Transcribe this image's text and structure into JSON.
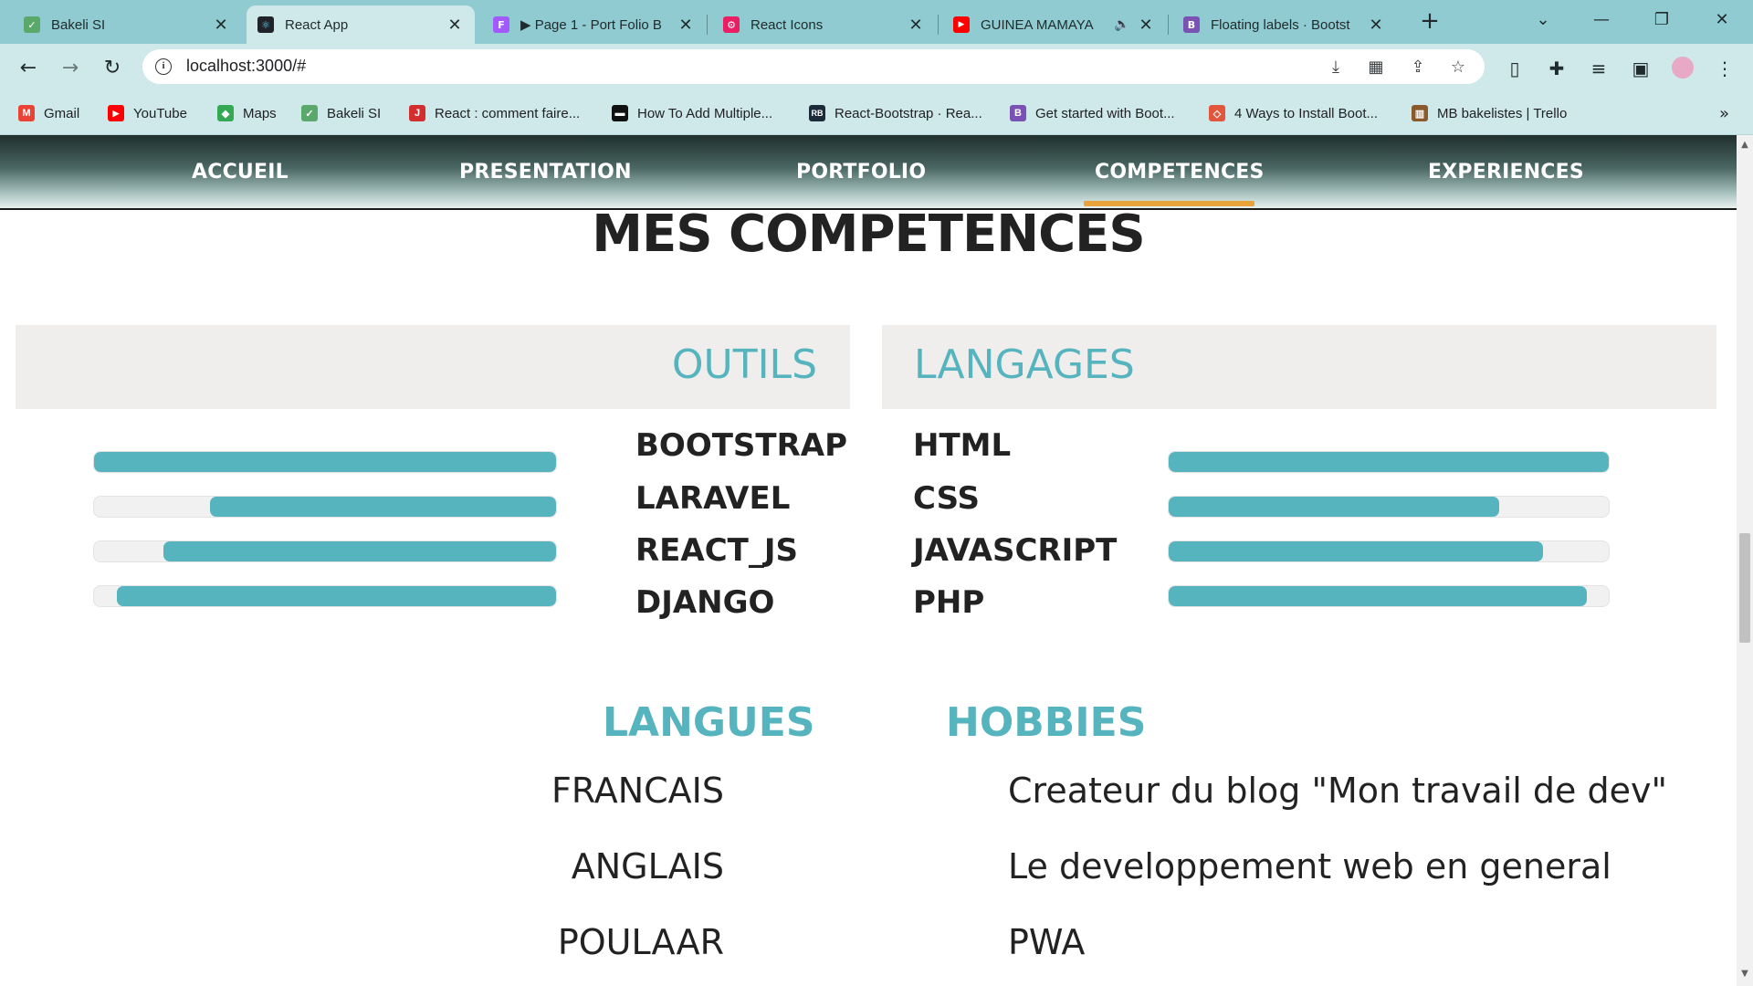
{
  "browser": {
    "tabs": [
      {
        "title": "Bakeli SI",
        "fav_color": "#5aa86a",
        "fav_glyph": "✓"
      },
      {
        "title": "React App",
        "fav_color": "#20232a",
        "fav_glyph": "⚛"
      },
      {
        "title": "▶ Page 1 - Port Folio B",
        "fav_color": "#a259ff",
        "fav_glyph": "F"
      },
      {
        "title": "React Icons",
        "fav_color": "#e91e63",
        "fav_glyph": "⚙"
      },
      {
        "title": "GUINEA MAMAYA",
        "fav_color": "#ff0000",
        "fav_glyph": "▶"
      },
      {
        "title": "Floating labels · Bootst",
        "fav_color": "#7952b3",
        "fav_glyph": "B"
      }
    ],
    "active_tab_index": 1,
    "url": "localhost:3000/#",
    "bookmarks": [
      {
        "label": "Gmail",
        "fav_color": "#ea4335",
        "fav_glyph": "M"
      },
      {
        "label": "YouTube",
        "fav_color": "#ff0000",
        "fav_glyph": "▶"
      },
      {
        "label": "Maps",
        "fav_color": "#34a853",
        "fav_glyph": "◆"
      },
      {
        "label": "Bakeli SI",
        "fav_color": "#5aa86a",
        "fav_glyph": "✓"
      },
      {
        "label": "React : comment faire...",
        "fav_color": "#d32f2f",
        "fav_glyph": "J"
      },
      {
        "label": "How To Add Multiple...",
        "fav_color": "#111111",
        "fav_glyph": "▬"
      },
      {
        "label": "React-Bootstrap · Rea...",
        "fav_color": "#1c2b3a",
        "fav_glyph": "RB"
      },
      {
        "label": "Get started with Boot...",
        "fav_color": "#7952b3",
        "fav_glyph": "B"
      },
      {
        "label": "4 Ways to Install Boot...",
        "fav_color": "#e2563b",
        "fav_glyph": "◇"
      },
      {
        "label": "MB bakelistes | Trello",
        "fav_color": "#8a5a2b",
        "fav_glyph": "▥"
      }
    ]
  },
  "site": {
    "nav": [
      "ACCUEIL",
      "PRESENTATION",
      "PORTFOLIO",
      "COMPETENCES",
      "EXPERIENCES"
    ],
    "active_nav": "COMPETENCES",
    "section_title": "MES COMPETENCES",
    "tools": {
      "heading": "OUTILS",
      "items": [
        {
          "label": "BOOTSTRAP",
          "level": 1.0
        },
        {
          "label": "LARAVEL",
          "level": 0.75
        },
        {
          "label": "REACT_JS",
          "level": 0.85
        },
        {
          "label": "DJANGO",
          "level": 0.95
        }
      ]
    },
    "languages_prog": {
      "heading": "LANGAGES",
      "items": [
        {
          "label": "HTML",
          "level": 1.0
        },
        {
          "label": "CSS",
          "level": 0.75
        },
        {
          "label": "JAVASCRIPT",
          "level": 0.85
        },
        {
          "label": "PHP",
          "level": 0.95
        }
      ]
    },
    "langues": {
      "heading": "LANGUES",
      "items": [
        "FRANCAIS",
        "ANGLAIS",
        "POULAAR"
      ]
    },
    "hobbies": {
      "heading": "HOBBIES",
      "items": [
        "Createur du blog \"Mon travail de dev\"",
        "Le developpement web en general",
        "PWA"
      ]
    },
    "accent_color": "#56b4be",
    "active_underline_color": "#e8a33a"
  }
}
